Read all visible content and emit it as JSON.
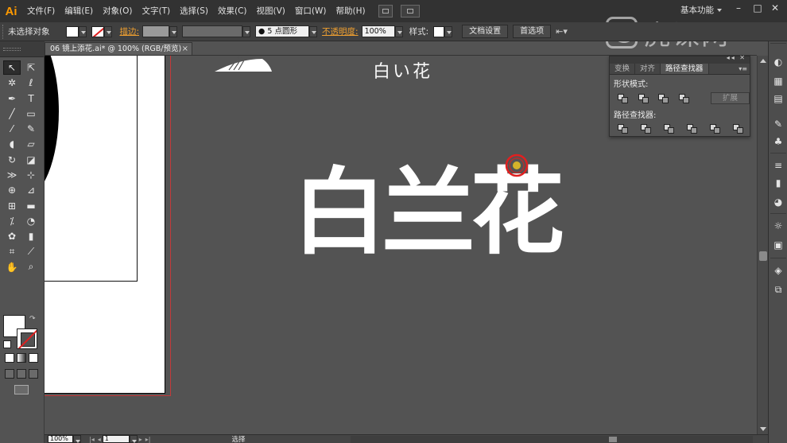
{
  "app": {
    "logo": "Ai",
    "menu": [
      "文件(F)",
      "编辑(E)",
      "对象(O)",
      "文字(T)",
      "选择(S)",
      "效果(C)",
      "视图(V)",
      "窗口(W)",
      "帮助(H)"
    ],
    "workspace": "基本功能",
    "window_controls": [
      "minimize-icon",
      "restore-icon",
      "close-icon"
    ]
  },
  "control_bar": {
    "selection_status": "未选择对象",
    "stroke_label": "描边:",
    "brush_value": "5 点圆形",
    "opacity_label": "不透明度:",
    "opacity_value": "100%",
    "style_label": "样式:",
    "doc_setup_button": "文档设置",
    "preferences_button": "首选项"
  },
  "document": {
    "tab_title": "06 镜上添花.ai* @ 100% (RGB/预览)",
    "close_glyph": "×",
    "jp_heading": "白い花",
    "main_title": "白兰花"
  },
  "pathfinder_panel": {
    "tabs": [
      "变换",
      "对齐",
      "路径查找器"
    ],
    "active_tab": "路径查找器",
    "shape_modes_label": "形状模式:",
    "pathfinders_label": "路径查找器:",
    "expand_button": "扩展"
  },
  "status_bar": {
    "zoom": "100%",
    "artboard_number": "1",
    "current_tool": "选择"
  },
  "watermark": {
    "text": "虎课网"
  },
  "colors": {
    "app_bg": "#535353",
    "menubar_bg": "#323232",
    "accent_orange": "#ff9a00",
    "artboard_guide": "#c23a3a",
    "cursor_ring": "#e02020",
    "cursor_dot": "#d4b32a"
  },
  "tools": [
    "selection-tool-icon",
    "direct-selection-tool-icon",
    "magic-wand-tool-icon",
    "lasso-tool-icon",
    "pen-tool-icon",
    "type-tool-icon",
    "line-tool-icon",
    "rectangle-tool-icon",
    "paintbrush-tool-icon",
    "pencil-tool-icon",
    "blob-brush-tool-icon",
    "eraser-tool-icon",
    "rotate-tool-icon",
    "scale-tool-icon",
    "width-tool-icon",
    "free-transform-tool-icon",
    "shape-builder-tool-icon",
    "perspective-grid-tool-icon",
    "mesh-tool-icon",
    "gradient-tool-icon",
    "eyedropper-tool-icon",
    "blend-tool-icon",
    "symbol-sprayer-tool-icon",
    "column-graph-tool-icon",
    "artboard-tool-icon",
    "slice-tool-icon",
    "hand-tool-icon",
    "zoom-tool-icon"
  ]
}
